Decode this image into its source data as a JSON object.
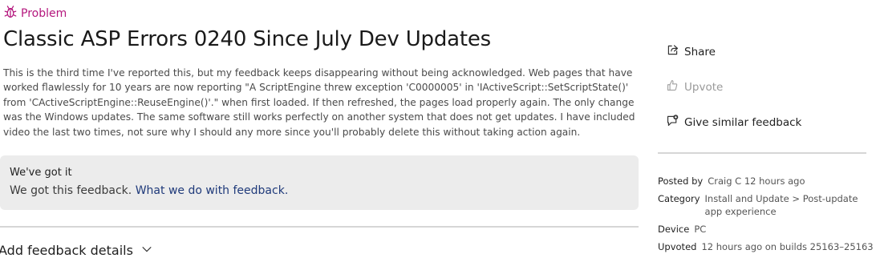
{
  "feedback": {
    "type_label": "Problem",
    "title": "Classic ASP Errors 0240 Since July Dev Updates",
    "description": "This is the third time I've reported this, but my feedback keeps disappearing without being acknowledged.  Web pages that have worked flawlessly for 10 years are now reporting \"A ScriptEngine threw exception 'C0000005' in 'IActiveScript::SetScriptState()' from 'CActiveScriptEngine::ReuseEngine()'.\" when first loaded.  If then refreshed, the pages load properly again.  The only change was the Windows updates.  The same software still works perfectly on another system that does not get updates.  I have included video the last two times, not sure why I should any more since you'll probably delete this without taking action again."
  },
  "status": {
    "title": "We've got it",
    "text": "We got this feedback.",
    "link": "What we do with feedback."
  },
  "add_details": {
    "label": "Add feedback details"
  },
  "actions": {
    "share": "Share",
    "upvote": "Upvote",
    "similar": "Give similar feedback"
  },
  "meta": {
    "posted_by_label": "Posted by",
    "posted_by_value": "Craig C 12 hours ago",
    "category_label": "Category",
    "category_value": "Install and Update > Post-update app experience",
    "device_label": "Device",
    "device_value": "PC",
    "upvoted_label": "Upvoted",
    "upvoted_value": "12 hours ago  on builds 25163–25163"
  },
  "colors": {
    "accent": "#b4177d",
    "link": "#1f3a7a",
    "card_bg": "#ececec"
  },
  "icons": {
    "type": "bug-icon",
    "share": "share-icon",
    "upvote": "thumbs-up-icon",
    "similar": "add-comment-icon",
    "expand": "chevron-down-icon"
  }
}
